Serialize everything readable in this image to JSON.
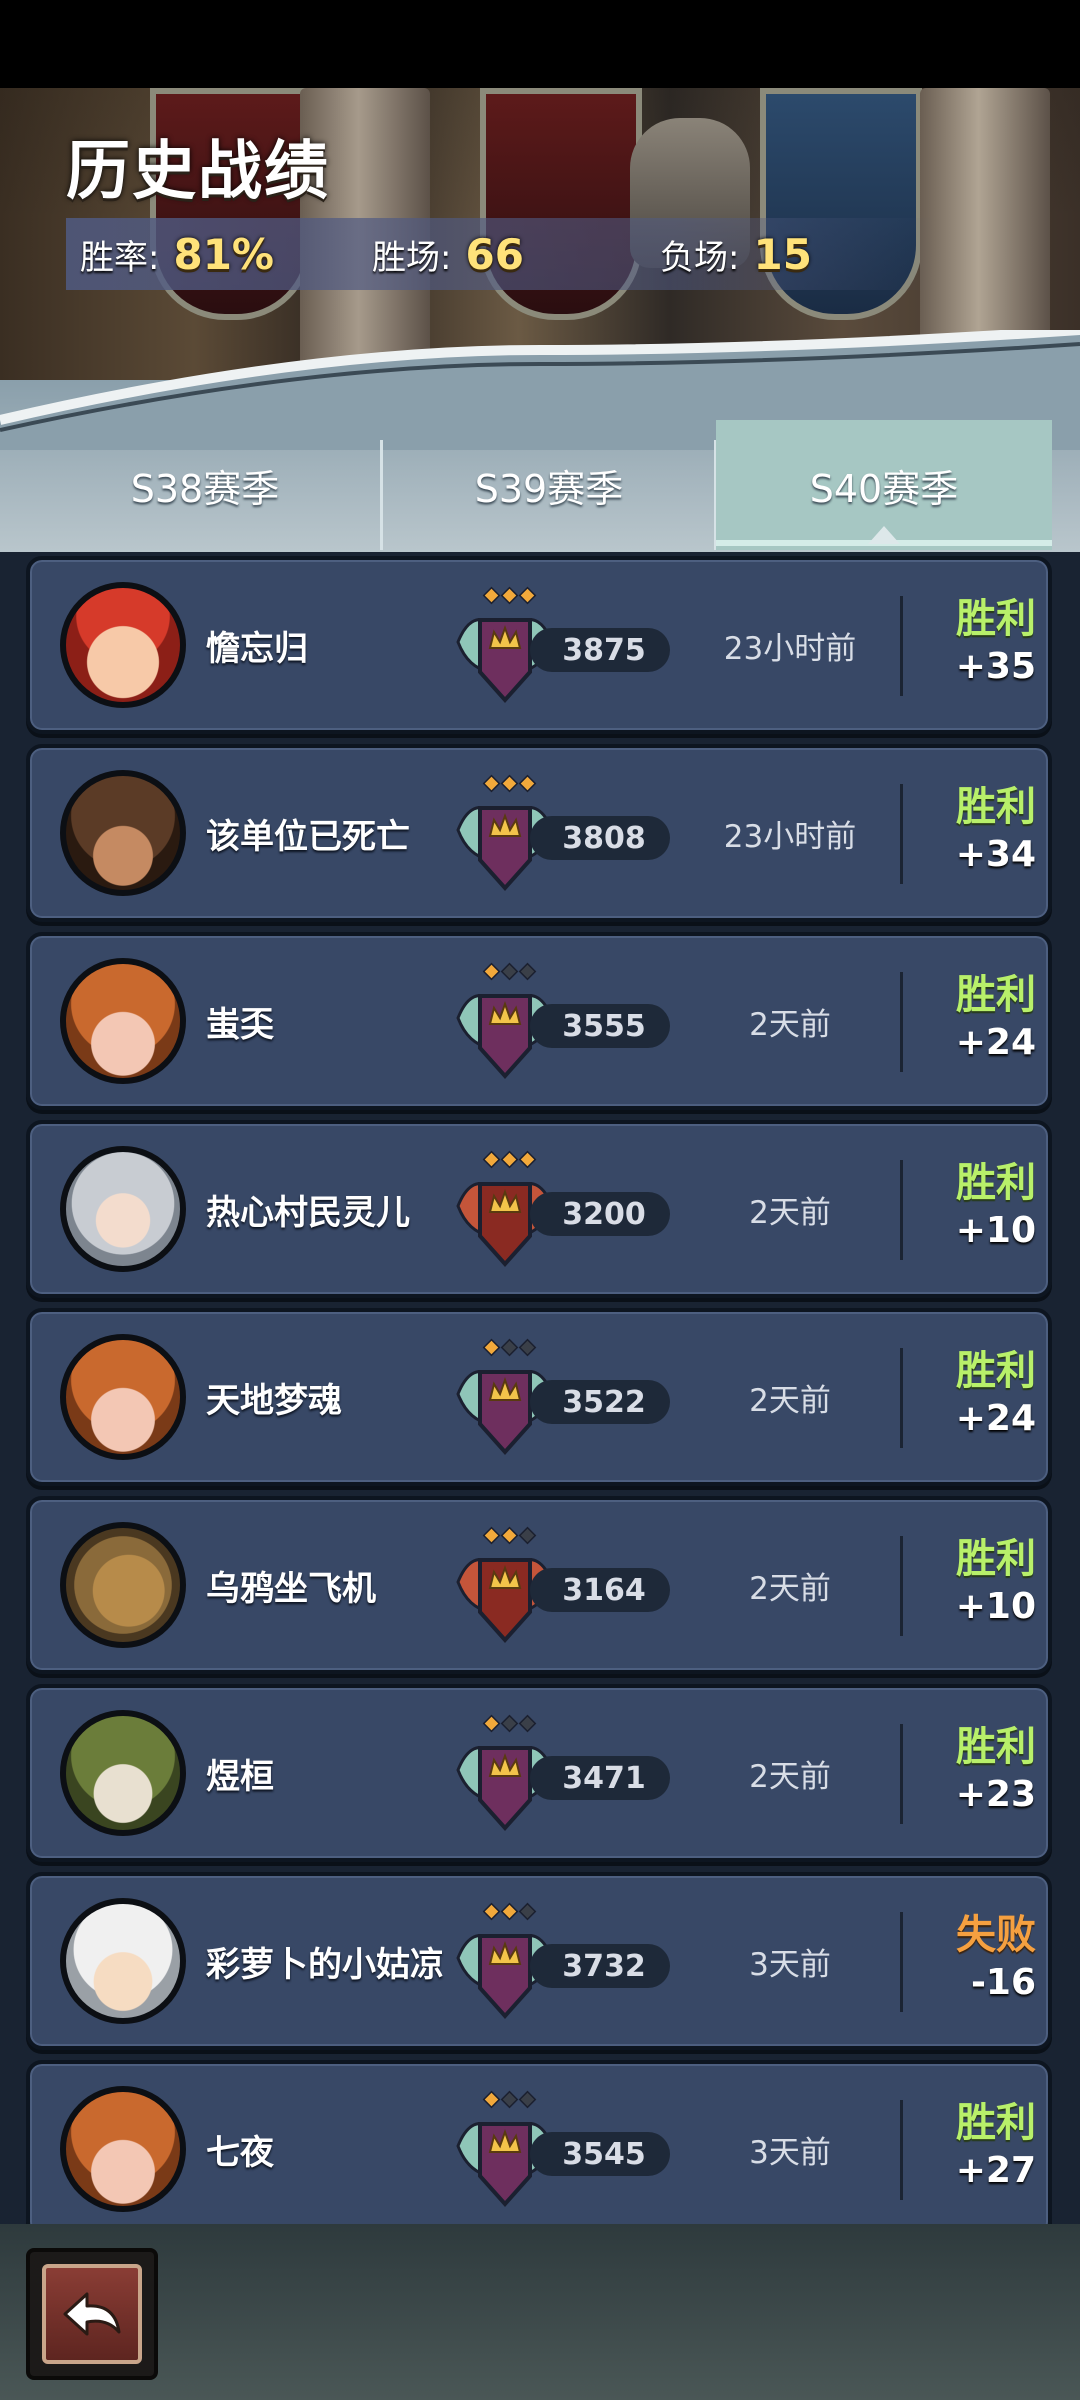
{
  "header": {
    "title": "历史战绩",
    "stats": [
      {
        "label": "胜率:",
        "value": "81%"
      },
      {
        "label": "胜场:",
        "value": "66"
      },
      {
        "label": "负场:",
        "value": "15"
      }
    ]
  },
  "tabs": [
    {
      "label": "S38赛季",
      "active": false
    },
    {
      "label": "S39赛季",
      "active": false
    },
    {
      "label": "S40赛季",
      "active": true
    }
  ],
  "matches": [
    {
      "name": "憺忘归",
      "score": "3875",
      "time": "23小时前",
      "result": "胜利",
      "delta": "+35",
      "outcome": "win",
      "stars": 3,
      "emblem": "winged-crown",
      "avatar": "strawberry"
    },
    {
      "name": "该单位已死亡",
      "score": "3808",
      "time": "23小时前",
      "result": "胜利",
      "delta": "+34",
      "outcome": "win",
      "stars": 3,
      "emblem": "winged-crown",
      "avatar": "cowboy"
    },
    {
      "name": "蚩奀",
      "score": "3555",
      "time": "2天前",
      "result": "胜利",
      "delta": "+24",
      "outcome": "win",
      "stars": 1,
      "emblem": "winged-crown",
      "avatar": "pumpkin"
    },
    {
      "name": "热心村民灵儿",
      "score": "3200",
      "time": "2天前",
      "result": "胜利",
      "delta": "+10",
      "outcome": "win",
      "stars": 3,
      "emblem": "red-crown",
      "avatar": "silver-hair"
    },
    {
      "name": "天地梦魂",
      "score": "3522",
      "time": "2天前",
      "result": "胜利",
      "delta": "+24",
      "outcome": "win",
      "stars": 1,
      "emblem": "winged-crown",
      "avatar": "pumpkin"
    },
    {
      "name": "乌鸦坐飞机",
      "score": "3164",
      "time": "2天前",
      "result": "胜利",
      "delta": "+10",
      "outcome": "win",
      "stars": 2,
      "emblem": "red-crown",
      "avatar": "wooden-mask"
    },
    {
      "name": "煜桓",
      "score": "3471",
      "time": "2天前",
      "result": "胜利",
      "delta": "+23",
      "outcome": "win",
      "stars": 1,
      "emblem": "winged-crown",
      "avatar": "raccoon"
    },
    {
      "name": "彩萝卜的小姑凉",
      "score": "3732",
      "time": "3天前",
      "result": "失败",
      "delta": "-16",
      "outcome": "lose",
      "stars": 2,
      "emblem": "winged-crown",
      "avatar": "panda-hood"
    },
    {
      "name": "七夜",
      "score": "3545",
      "time": "3天前",
      "result": "胜利",
      "delta": "+27",
      "outcome": "win",
      "stars": 1,
      "emblem": "winged-crown",
      "avatar": "pumpkin"
    }
  ],
  "colors": {
    "win": "#b8f06a",
    "lose": "#f5a040",
    "card": "#384866",
    "gold": "#ffe27a"
  },
  "icons": {
    "back": "back-arrow-icon"
  }
}
